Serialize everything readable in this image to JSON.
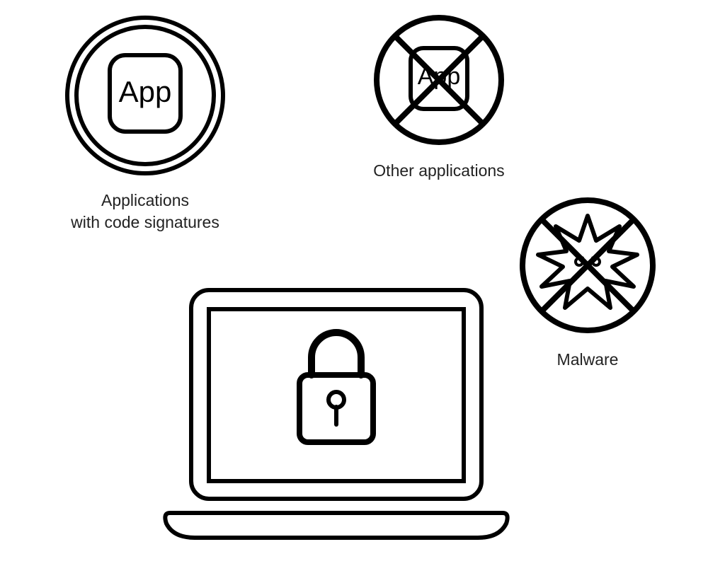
{
  "elements": {
    "signed_apps": {
      "icon_text": "App",
      "label": "Applications\nwith code signatures"
    },
    "other_apps": {
      "icon_text": "App",
      "label": "Other applications"
    },
    "malware": {
      "label": "Malware"
    },
    "secure_laptop": {
      "label": ""
    }
  }
}
